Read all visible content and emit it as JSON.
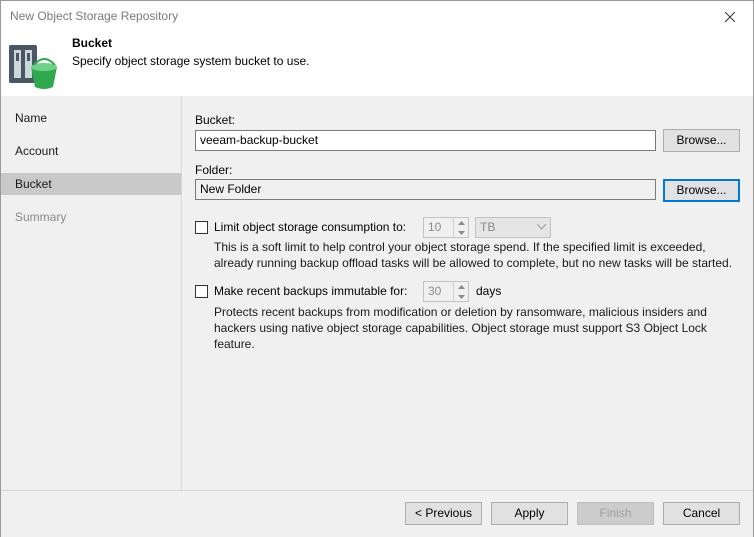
{
  "window": {
    "title": "New Object Storage Repository"
  },
  "header": {
    "title": "Bucket",
    "subtitle": "Specify object storage system bucket to use."
  },
  "steps": [
    {
      "label": "Name"
    },
    {
      "label": "Account"
    },
    {
      "label": "Bucket"
    },
    {
      "label": "Summary"
    }
  ],
  "bucket": {
    "label": "Bucket:",
    "value": "veeam-backup-bucket",
    "browse_label": "Browse..."
  },
  "folder": {
    "label": "Folder:",
    "value": "New Folder",
    "browse_label": "Browse..."
  },
  "limit": {
    "checked": false,
    "label": "Limit object storage consumption to:",
    "value": "10",
    "unit": "TB",
    "description_line1": "This is a soft limit to help control your object storage spend. If the specified limit is exceeded,",
    "description_line2": "already running backup offload tasks will be allowed to complete, but no new tasks will be started."
  },
  "immutable": {
    "checked": false,
    "label": "Make recent backups immutable for:",
    "value": "30",
    "unit_label": "days",
    "description_line1": "Protects recent backups from modification or deletion by ransomware, malicious insiders and",
    "description_line2": "hackers using native object storage capabilities. Object storage must support S3 Object Lock",
    "description_line3": "feature."
  },
  "footer": {
    "previous_label": "< Previous",
    "apply_label": "Apply",
    "finish_label": "Finish",
    "cancel_label": "Cancel"
  }
}
